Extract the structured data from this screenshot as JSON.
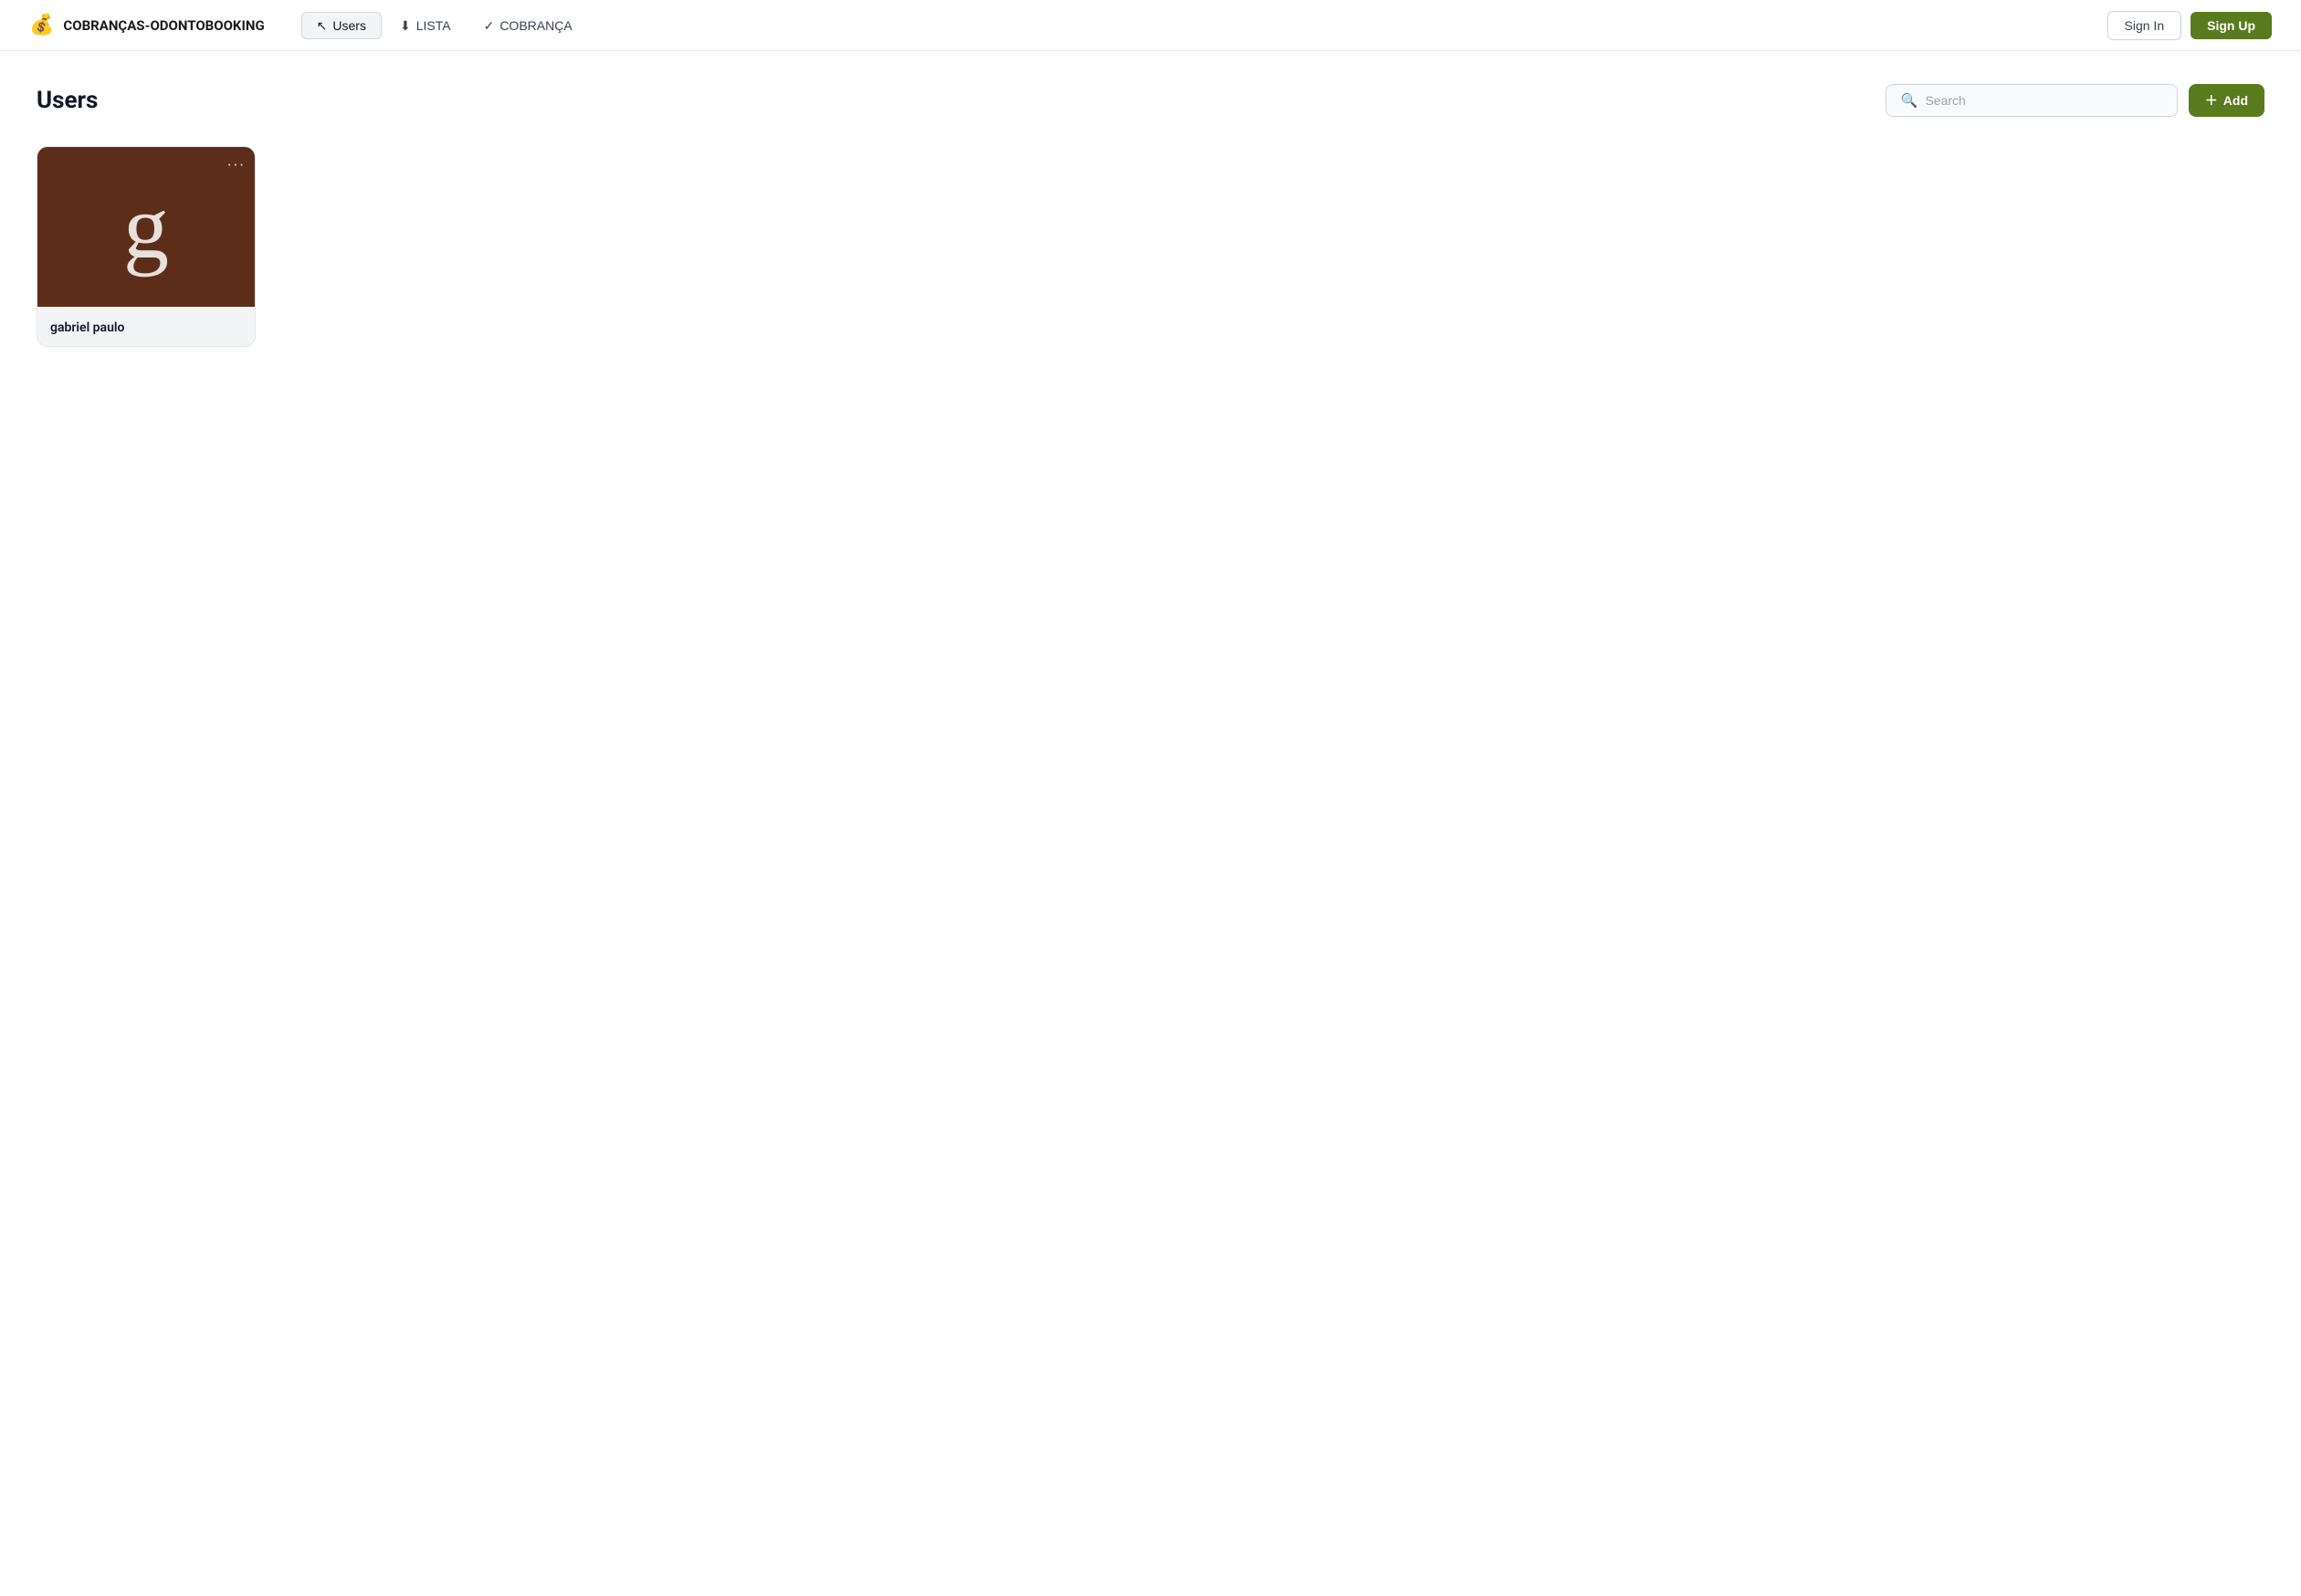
{
  "brand": {
    "icon": "💰",
    "name": "COBRANÇAS-ODONTOBOOKING"
  },
  "nav": {
    "items": [
      {
        "id": "users",
        "label": "Users",
        "icon": "↖",
        "active": true
      },
      {
        "id": "lista",
        "label": "LISTA",
        "icon": "⬇",
        "active": false
      },
      {
        "id": "cobranca",
        "label": "COBRANÇA",
        "icon": "✓",
        "active": false
      }
    ]
  },
  "header_actions": {
    "sign_in_label": "Sign In",
    "sign_up_label": "Sign Up"
  },
  "page": {
    "title": "Users"
  },
  "search": {
    "placeholder": "Search"
  },
  "add_button": {
    "label": "Add"
  },
  "users": [
    {
      "id": "gabriel-paulo",
      "name": "gabriel paulo",
      "letter": "g",
      "bg_color": "#5c2e1a"
    }
  ]
}
